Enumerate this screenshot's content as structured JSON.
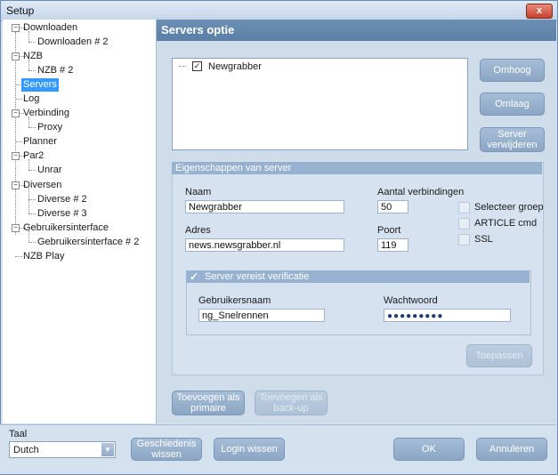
{
  "window": {
    "title": "Setup",
    "close_label": "x"
  },
  "tree": {
    "items": [
      {
        "label": "Downloaden"
      },
      {
        "label": "Downloaden # 2"
      },
      {
        "label": "NZB"
      },
      {
        "label": "NZB # 2"
      },
      {
        "label": "Servers"
      },
      {
        "label": "Log"
      },
      {
        "label": "Verbinding"
      },
      {
        "label": "Proxy"
      },
      {
        "label": "Planner"
      },
      {
        "label": "Par2"
      },
      {
        "label": "Unrar"
      },
      {
        "label": "Diversen"
      },
      {
        "label": "Diverse # 2"
      },
      {
        "label": "Diverse # 3"
      },
      {
        "label": "Gebruikersinterface"
      },
      {
        "label": "Gebruikersinterface # 2"
      },
      {
        "label": "NZB Play"
      }
    ],
    "selected": "Servers"
  },
  "panel": {
    "title": "Servers optie",
    "server_list": [
      {
        "name": "Newgrabber",
        "checked": true
      }
    ],
    "buttons": {
      "up": "Omhoog",
      "down": "Omlaag",
      "remove_line1": "Server",
      "remove_line2": "verwijderen"
    }
  },
  "properties": {
    "title": "Eigenschappen van server",
    "name_label": "Naam",
    "name_value": "Newgrabber",
    "connections_label": "Aantal verbindingen",
    "connections_value": "50",
    "address_label": "Adres",
    "address_value": "news.newsgrabber.nl",
    "port_label": "Poort",
    "port_value": "119",
    "options": [
      {
        "label": "Selecteer groep",
        "checked": false
      },
      {
        "label": "ARTICLE cmd",
        "checked": false
      },
      {
        "label": "SSL",
        "checked": false
      }
    ],
    "auth": {
      "title": "Server vereist verificatie",
      "checked": true,
      "username_label": "Gebruikersnaam",
      "username_value": "ng_Snelrennen",
      "password_label": "Wachtwoord",
      "password_value": "●●●●●●●●●"
    },
    "apply_label": "Toepassen"
  },
  "bottom_buttons": {
    "add_primary_line1": "Toevoegen als",
    "add_primary_line2": "primaire",
    "add_backup_line1": "Toevoegen als",
    "add_backup_line2": "back-up"
  },
  "footer": {
    "language_label": "Taal",
    "language_value": "Dutch",
    "history_line1": "Geschiedenis",
    "history_line2": "wissen",
    "login_clear": "Login wissen",
    "ok": "OK",
    "cancel": "Annuleren"
  },
  "colors": {
    "header": "#5f83ab",
    "selected": "#3399ff",
    "button": "#97b0cd"
  }
}
